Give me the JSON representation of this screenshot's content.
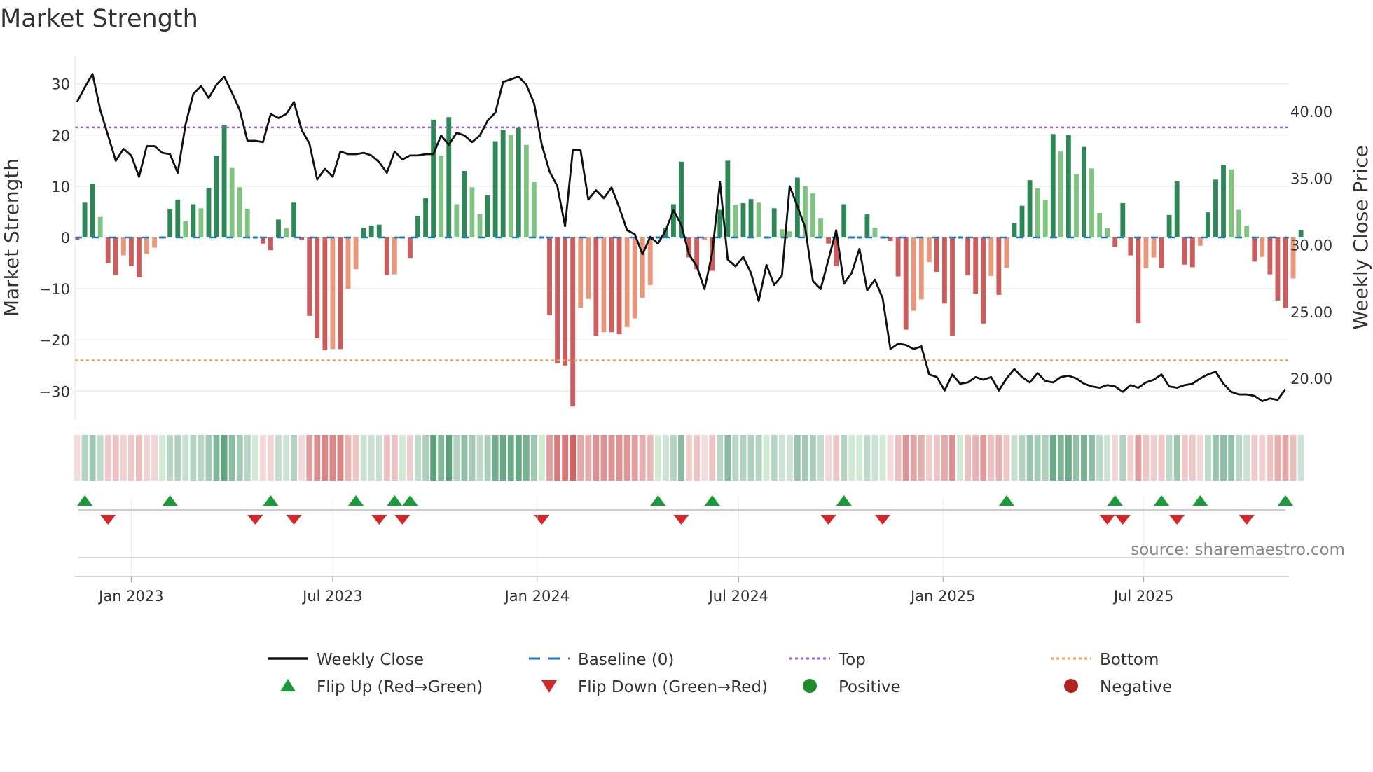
{
  "title": "Market Strength",
  "source": "source: sharemaestro.com",
  "colors": {
    "pos_dark": "#2e8856",
    "pos_light": "#7fc381",
    "neg_dark": "#cd5c5c",
    "neg_light": "#e8977a",
    "price": "#111111",
    "baseline": "#1f77b4",
    "top": "#9b59e6",
    "bottom": "#f0a25a",
    "flip_up": "#1a9a3a",
    "flip_down": "#d62728"
  },
  "chart_data": {
    "type": "bar",
    "title": "Market Strength",
    "ylabel": "Market Strength",
    "y2label": "Weekly Close Price",
    "ylim": [
      -35,
      36
    ],
    "y2lim": [
      17.5,
      44
    ],
    "yticks": [
      "30",
      "20",
      "10",
      "0",
      "−10",
      "−20",
      "−30"
    ],
    "ytick_values": [
      30,
      20,
      10,
      0,
      -10,
      -20,
      -30
    ],
    "y2ticks": [
      "40.00",
      "35.00",
      "30.00",
      "25.00",
      "20.00"
    ],
    "y2tick_values": [
      40,
      35,
      30,
      25,
      20
    ],
    "xticks": [
      {
        "label": "Jan 2023",
        "week": 7
      },
      {
        "label": "Jul 2023",
        "week": 33
      },
      {
        "label": "Jan 2024",
        "week": 59.4
      },
      {
        "label": "Jul 2024",
        "week": 85.4
      },
      {
        "label": "Jan 2025",
        "week": 111.8
      },
      {
        "label": "Jul 2025",
        "week": 137.7
      }
    ],
    "top": 21.5,
    "bottom": -24,
    "baseline": 0,
    "strength": [
      -0.5,
      6.8,
      10.5,
      4,
      -5,
      -7.3,
      -3.5,
      -5.5,
      -7.8,
      -3.2,
      -2,
      0,
      5.6,
      7.4,
      3.2,
      6.5,
      5.7,
      9.6,
      16,
      22,
      13.6,
      9.8,
      5.6,
      0,
      -1.2,
      -2.5,
      3.5,
      1.8,
      6.8,
      -0.5,
      -15.3,
      -19.7,
      -22,
      -21.8,
      -21.8,
      -10,
      -6.2,
      1.9,
      2.3,
      2.5,
      -7.3,
      -7.2,
      0,
      -4,
      4.2,
      7.7,
      23,
      16,
      23.5,
      6.5,
      13,
      9.8,
      4.6,
      8.2,
      18.8,
      21,
      20,
      21.4,
      18.1,
      10.8,
      0,
      -15.2,
      -24.5,
      -25,
      -33,
      -13.7,
      -12,
      -19.2,
      -18.5,
      -18.5,
      -18.9,
      -17.5,
      -15.8,
      -11.8,
      -9.3,
      0,
      1.9,
      6.5,
      14.8,
      -3.9,
      -6.2,
      -0.5,
      -6.5,
      5.4,
      15,
      6.3,
      6.7,
      7.5,
      6.8,
      0,
      5.7,
      1.6,
      1.2,
      11.7,
      10,
      8.6,
      3.8,
      -1.2,
      -5.6,
      6.5,
      0,
      0,
      4.5,
      1.9,
      0,
      -0.7,
      -7.6,
      -18,
      -14.3,
      -12.1,
      -4.8,
      -6.7,
      -12.9,
      -19.2,
      0,
      -7.4,
      -11,
      -16.8,
      -7.5,
      -11.2,
      -5.9,
      2.8,
      6.2,
      11.2,
      9.6,
      7.3,
      20.2,
      16.8,
      20,
      12.4,
      17.7,
      13.5,
      4.8,
      1.8,
      -1.8,
      6.7,
      -3.5,
      -16.7,
      -6,
      -3.9,
      -5.9,
      4.4,
      11,
      -5.3,
      -5.8,
      -1.6,
      4.9,
      11.3,
      14.2,
      13.3,
      5.4,
      2.2,
      -4.7,
      -3.8,
      -7.2,
      -12.3,
      -13.8,
      -8,
      1.5
    ],
    "weekly_close": [
      40.7,
      41.8,
      42.8,
      40.1,
      38.2,
      36.3,
      37.2,
      36.7,
      35.1,
      37.4,
      37.4,
      36.9,
      36.8,
      35.4,
      39,
      41.3,
      41.9,
      41,
      42,
      42.6,
      41.4,
      40.1,
      37.8,
      37.8,
      37.7,
      39.8,
      39.5,
      39.8,
      40.7,
      38.6,
      37.6,
      34.9,
      35.7,
      35.1,
      37,
      36.8,
      36.8,
      36.9,
      36.7,
      36.2,
      35.4,
      37,
      36.4,
      36.7,
      36.7,
      36.8,
      36.8,
      38.2,
      37.5,
      38.4,
      38.2,
      37.7,
      38.2,
      39.3,
      39.9,
      42.2,
      42.4,
      42.6,
      42,
      40.6,
      37.5,
      35.5,
      34.4,
      31.4,
      37.1,
      37.1,
      33.4,
      34.1,
      33.5,
      34.3,
      32.8,
      31.1,
      30.8,
      29.3,
      30.6,
      30.1,
      31.1,
      32.6,
      31.5,
      29.3,
      28.4,
      26.7,
      29.4,
      34.7,
      28.9,
      28.4,
      29.1,
      27.9,
      25.8,
      28.5,
      27,
      27.7,
      34.4,
      32.9,
      31.3,
      27.3,
      26.7,
      28.9,
      31.1,
      27.1,
      27.9,
      29.7,
      26.6,
      27.4,
      26,
      22.2,
      22.6,
      22.5,
      22.2,
      22.4,
      20.3,
      20.1,
      19.1,
      20.3,
      19.6,
      19.7,
      20.1,
      19.9,
      20.1,
      19.1,
      20,
      20.7,
      20.1,
      19.7,
      20.4,
      19.8,
      19.7,
      20.1,
      20.2,
      20,
      19.6,
      19.4,
      19.3,
      19.5,
      19.4,
      19,
      19.5,
      19.3,
      19.7,
      19.9,
      20.3,
      19.4,
      19.3,
      19.5,
      19.6,
      20,
      20.3,
      20.5,
      19.6,
      19,
      18.8,
      18.8,
      18.7,
      18.3,
      18.5,
      18.4,
      19.2
    ],
    "flip_up_weeks": [
      1,
      12,
      25,
      36,
      41,
      43,
      75,
      82,
      99,
      120,
      134,
      140,
      145,
      156
    ],
    "flip_down_weeks": [
      4,
      23,
      28,
      39,
      42,
      60,
      78,
      97,
      104,
      133,
      135,
      142,
      151
    ]
  },
  "legend": [
    {
      "label": "Weekly Close",
      "key": "line"
    },
    {
      "label": "Baseline (0)",
      "key": "dash"
    },
    {
      "label": "Top",
      "key": "top"
    },
    {
      "label": "Bottom",
      "key": "bottom"
    },
    {
      "label": "Flip Up (Red→Green)",
      "key": "up"
    },
    {
      "label": "Flip Down (Green→Red)",
      "key": "down"
    },
    {
      "label": "Positive",
      "key": "pos"
    },
    {
      "label": "Negative",
      "key": "neg"
    }
  ]
}
